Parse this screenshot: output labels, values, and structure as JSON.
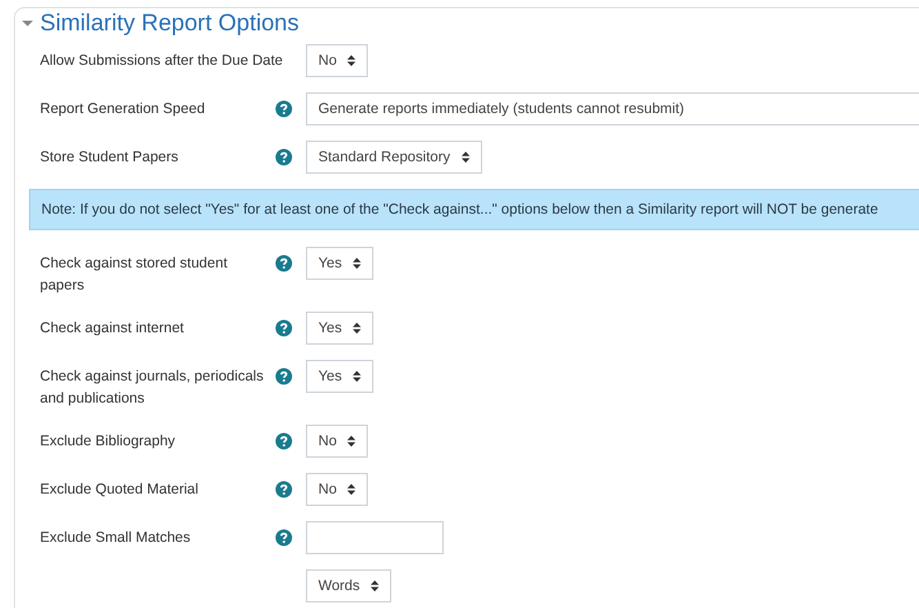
{
  "section": {
    "title": "Similarity Report Options",
    "expanded": true
  },
  "rows": [
    {
      "kind": "field",
      "label": "Allow Submissions after the Due Date",
      "help": false,
      "control": {
        "kind": "select",
        "value": "No"
      }
    },
    {
      "kind": "field",
      "label": "Report Generation Speed",
      "help": true,
      "control": {
        "kind": "wide-select",
        "value": "Generate reports immediately (students cannot resubmit)"
      }
    },
    {
      "kind": "field",
      "label": "Store Student Papers",
      "help": true,
      "control": {
        "kind": "select",
        "value": "Standard Repository"
      }
    },
    {
      "kind": "note",
      "text": "Note: If you do not select \"Yes\" for at least one of the \"Check against...\" options below then a Similarity report will NOT be generate"
    },
    {
      "kind": "field",
      "label": "Check against stored student papers",
      "help": true,
      "control": {
        "kind": "select",
        "value": "Yes"
      }
    },
    {
      "kind": "field",
      "label": "Check against internet",
      "help": true,
      "control": {
        "kind": "select",
        "value": "Yes"
      }
    },
    {
      "kind": "field",
      "label": "Check against journals, periodicals and publications",
      "help": true,
      "control": {
        "kind": "select",
        "value": "Yes"
      }
    },
    {
      "kind": "field",
      "label": "Exclude Bibliography",
      "help": true,
      "control": {
        "kind": "select",
        "value": "No"
      }
    },
    {
      "kind": "field",
      "label": "Exclude Quoted Material",
      "help": true,
      "control": {
        "kind": "select",
        "value": "No"
      }
    },
    {
      "kind": "field",
      "label": "Exclude Small Matches",
      "help": true,
      "control": {
        "kind": "text"
      }
    },
    {
      "kind": "field",
      "help": false,
      "control": {
        "kind": "select",
        "value": "Words"
      }
    }
  ]
}
